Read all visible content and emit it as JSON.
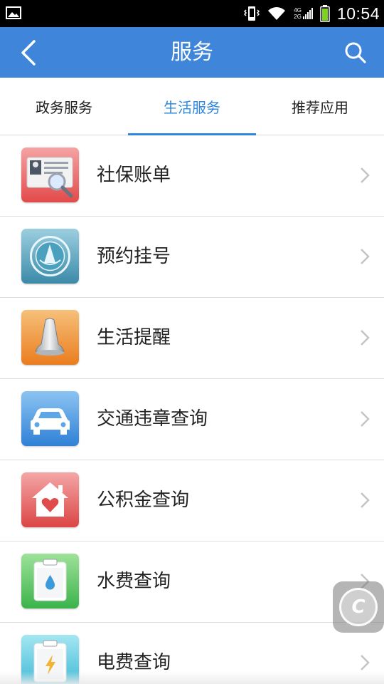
{
  "status_bar": {
    "time": "10:54",
    "network_4g": "4G",
    "network_2g": "2G",
    "icons": [
      "image-notification-icon",
      "vibrate-icon",
      "wifi-icon",
      "signal-icon",
      "battery-icon"
    ]
  },
  "app_bar": {
    "title": "服务",
    "back_icon": "chevron-left-icon",
    "search_icon": "search-icon"
  },
  "tabs": [
    {
      "label": "政务服务",
      "active": false
    },
    {
      "label": "生活服务",
      "active": true
    },
    {
      "label": "推荐应用",
      "active": false
    }
  ],
  "colors": {
    "primary": "#3f85d9",
    "active_tab": "#2f86dd"
  },
  "services": [
    {
      "label": "社保账单",
      "icon": "id-card-magnifier-icon"
    },
    {
      "label": "预约挂号",
      "icon": "hospital-emblem-icon"
    },
    {
      "label": "生活提醒",
      "icon": "bell-icon"
    },
    {
      "label": "交通违章查询",
      "icon": "car-icon"
    },
    {
      "label": "公积金查询",
      "icon": "house-heart-icon"
    },
    {
      "label": "水费查询",
      "icon": "water-drop-clipboard-icon"
    },
    {
      "label": "电费查询",
      "icon": "lightning-clipboard-icon"
    }
  ],
  "floating_button": {
    "letter": "C"
  }
}
